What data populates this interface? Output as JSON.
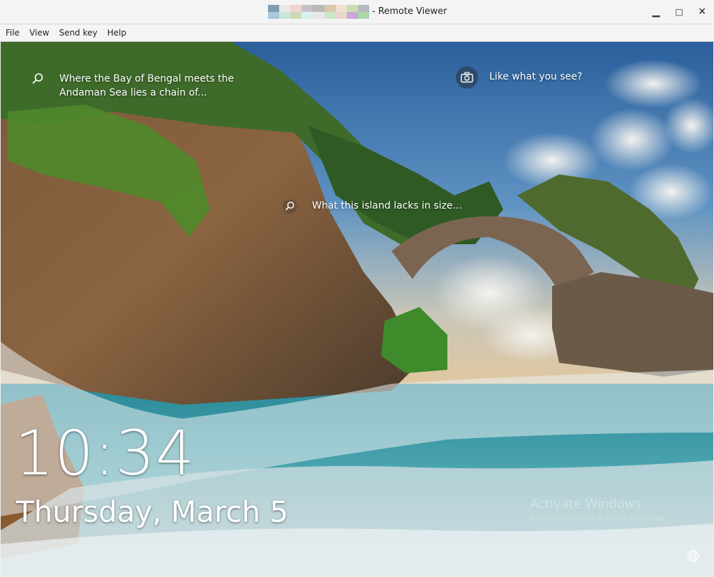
{
  "window": {
    "title": "- Remote Viewer",
    "icon_colors": [
      "#7f9bb0",
      "#e8e8e8",
      "#f0d4d4",
      "#c8c0c8",
      "#b8b8b8",
      "#d8c8a8",
      "#f0e0d0",
      "#c8e0b0",
      "#b8b8c0",
      "#a8c8d8",
      "#c8e8d8",
      "#d0d8b8",
      "#d8f0f0",
      "#e8e8e8",
      "#c8e8c8",
      "#e8d8c8",
      "#c8a8d8",
      "#a8d8a8"
    ],
    "minimize": "▁",
    "maximize": "□",
    "close": "✕"
  },
  "menu": {
    "file": "File",
    "view": "View",
    "send_key": "Send key",
    "help": "Help"
  },
  "lockscreen": {
    "spotlight_1": {
      "line1": "Where the Bay of Bengal meets the",
      "line2": "Andaman Sea lies a chain of..."
    },
    "like_prompt": "Like what you see?",
    "spotlight_2": "What this island lacks in size...",
    "time": "10:34",
    "date": "Thursday, March 5",
    "watermark": "Activate Windows",
    "watermark_sub": "Go to Settings to activate Windows.",
    "icons": {
      "search": "search-icon",
      "camera": "camera-icon",
      "globe": "globe-icon"
    }
  }
}
